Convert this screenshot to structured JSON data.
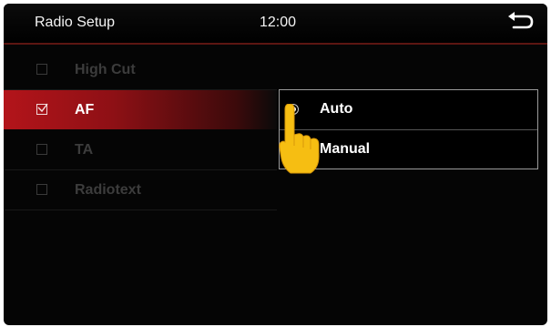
{
  "header": {
    "title": "Radio Setup",
    "clock": "12:00",
    "back_icon": "back-arrow-icon"
  },
  "options": [
    {
      "label": "High Cut",
      "checked": false,
      "enabled": false
    },
    {
      "label": "AF",
      "checked": true,
      "enabled": true,
      "selected": true
    },
    {
      "label": "TA",
      "checked": false,
      "enabled": false
    },
    {
      "label": "Radiotext",
      "checked": false,
      "enabled": false
    }
  ],
  "popup": {
    "items": [
      {
        "label": "Auto",
        "selected": true
      },
      {
        "label": "Manual",
        "selected": false
      }
    ]
  },
  "overlay": {
    "icon": "pointing-hand-icon"
  },
  "colors": {
    "background": "#050505",
    "accent_red": "#b3141a",
    "text": "#ffffff",
    "disabled_text": "#3c3c3c",
    "hand_yellow": "#f6be12"
  }
}
